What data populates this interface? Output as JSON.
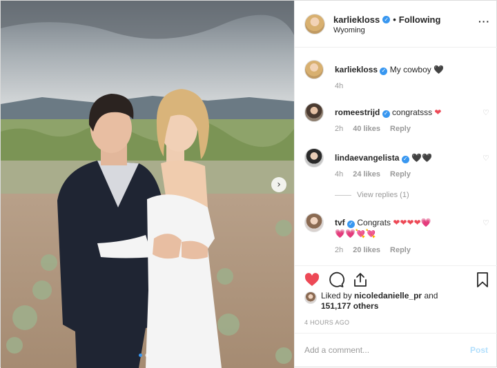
{
  "post": {
    "username": "karliekloss",
    "follow_status": "Following",
    "separator": "•",
    "location": "Wyoming",
    "more_icon": "more-dots-icon",
    "verified_mark": "✓"
  },
  "caption": {
    "username": "karliekloss",
    "text": "My cowboy",
    "emoji": "🖤",
    "age": "4h"
  },
  "comments": [
    {
      "username": "romeestrijd",
      "text": "congratsss",
      "emoji": "❤",
      "age": "2h",
      "likes": "40 likes",
      "reply": "Reply"
    },
    {
      "username": "lindaevangelista",
      "text": "",
      "emoji": "🖤🖤",
      "age": "4h",
      "likes": "24 likes",
      "reply": "Reply"
    },
    {
      "username": "tvf",
      "text": "Congrats",
      "emoji": "❤❤❤❤💗",
      "emoji_line2": "💗💗💘💘",
      "age": "2h",
      "likes": "20 likes",
      "reply": "Reply"
    }
  ],
  "view_replies": "View replies (1)",
  "likes": {
    "prefix": "Liked by",
    "user": "nicoledanielle_pr",
    "and": "and",
    "others": "151,177 others"
  },
  "timestamp": "4 HOURS AGO",
  "add_comment": {
    "placeholder": "Add a comment...",
    "post_label": "Post"
  },
  "colors": {
    "like_red": "#ed4956",
    "verified_blue": "#3897f0",
    "post_disabled": "#b2dffc"
  },
  "icons": [
    "heart-icon",
    "comment-icon",
    "share-icon",
    "bookmark-icon",
    "next-arrow-icon"
  ]
}
